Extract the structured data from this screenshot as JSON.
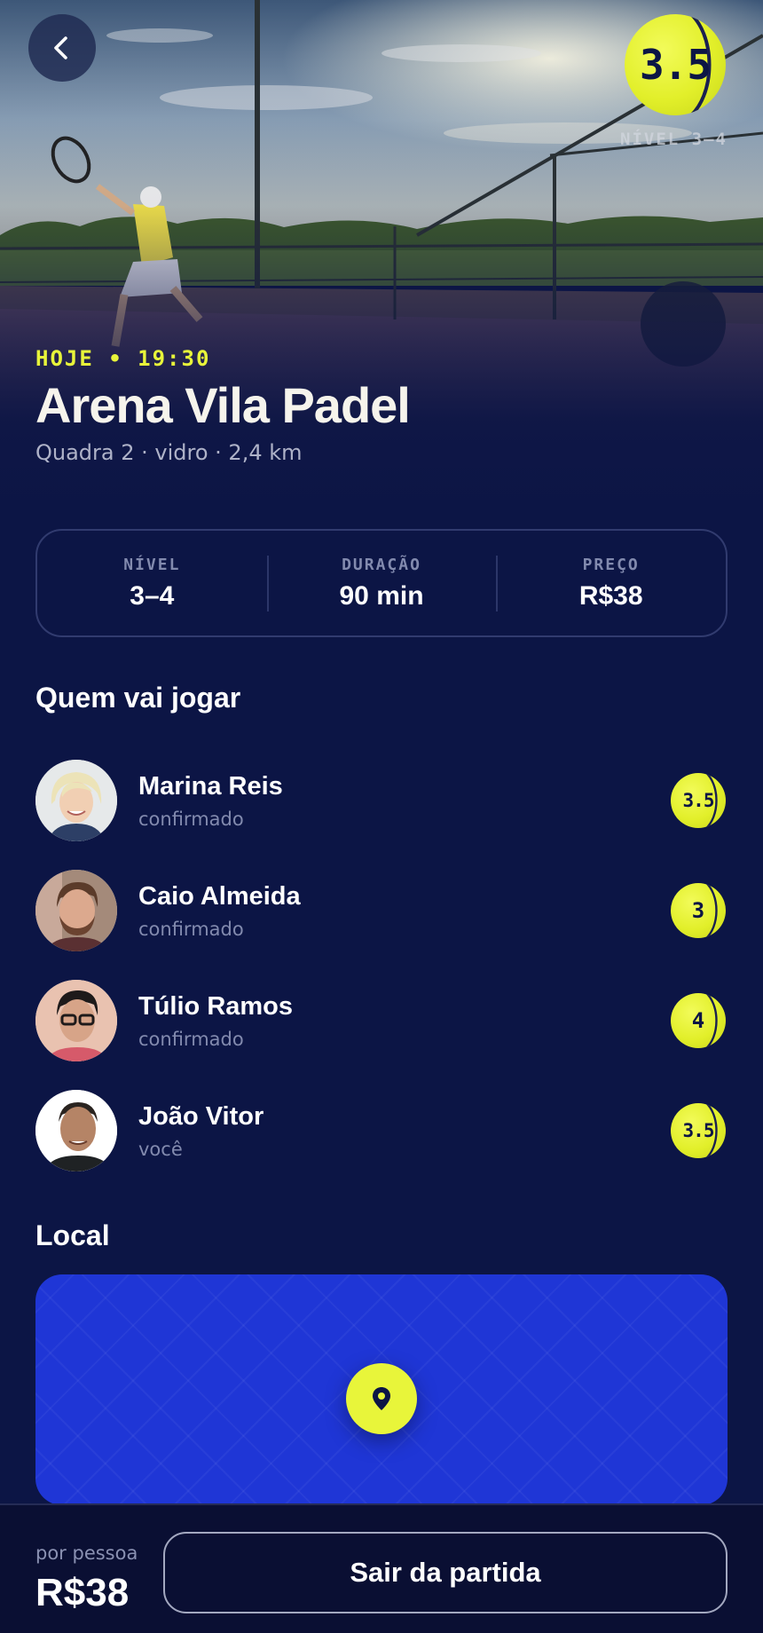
{
  "header": {
    "level_ball": "3.5",
    "level_caption": "NÍVEL 3–4"
  },
  "match": {
    "when": "HOJE • 19:30",
    "venue": "Arena Vila Padel",
    "details": "Quadra 2 · vidro · 2,4 km"
  },
  "stats": [
    {
      "label": "NÍVEL",
      "value": "3–4"
    },
    {
      "label": "DURAÇÃO",
      "value": "90 min"
    },
    {
      "label": "PREÇO",
      "value": "R$38"
    }
  ],
  "players_section": {
    "title": "Quem vai jogar",
    "players": [
      {
        "name": "Marina Reis",
        "status": "confirmado",
        "level": "3.5"
      },
      {
        "name": "Caio Almeida",
        "status": "confirmado",
        "level": "3"
      },
      {
        "name": "Túlio Ramos",
        "status": "confirmado",
        "level": "4"
      },
      {
        "name": "João Vitor",
        "status": "você",
        "level": "3.5"
      }
    ]
  },
  "location_section": {
    "title": "Local"
  },
  "footer": {
    "price_caption": "por pessoa",
    "price": "R$38",
    "leave_label": "Sair da partida"
  },
  "colors": {
    "background": "#0c1545",
    "accent": "#e8f53a",
    "map": "#1f36d6"
  },
  "icons": [
    "chevron-left-icon",
    "tennis-ball-icon",
    "map-pin-icon"
  ]
}
